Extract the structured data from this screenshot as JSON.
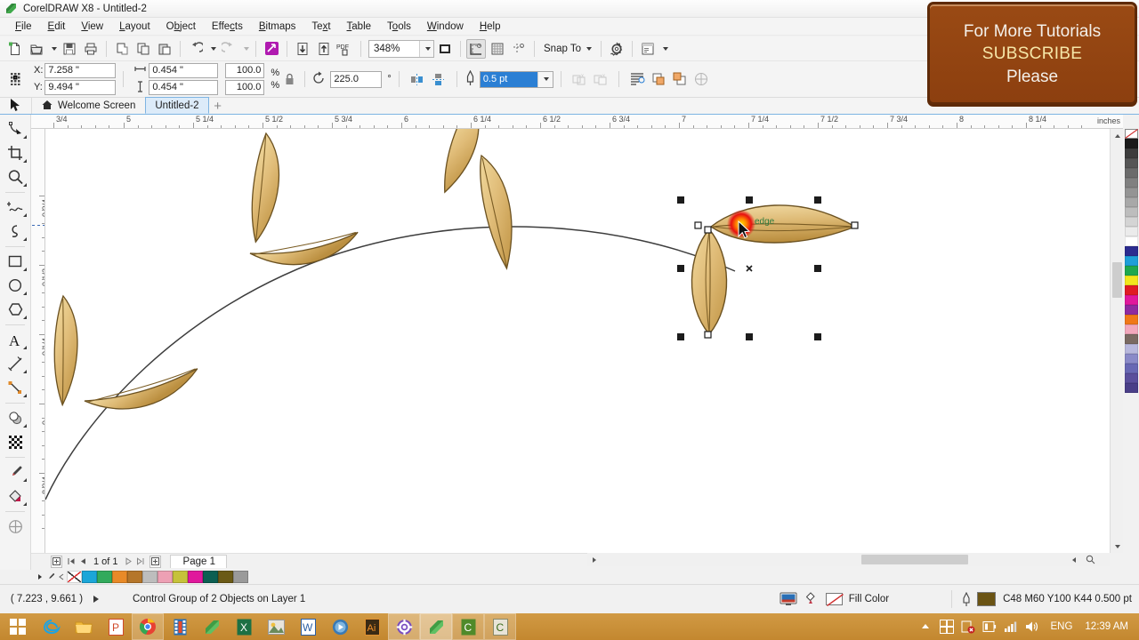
{
  "window": {
    "title": "CorelDRAW X8 - Untitled-2",
    "app_icon": "coreldraw-logo-icon"
  },
  "menu": [
    {
      "label": "File",
      "accel": "F"
    },
    {
      "label": "Edit",
      "accel": "E"
    },
    {
      "label": "View",
      "accel": "V"
    },
    {
      "label": "Layout",
      "accel": "L"
    },
    {
      "label": "Object",
      "accel": "O"
    },
    {
      "label": "Effects",
      "accel": "c"
    },
    {
      "label": "Bitmaps",
      "accel": "B"
    },
    {
      "label": "Text",
      "accel": "x"
    },
    {
      "label": "Table",
      "accel": "T"
    },
    {
      "label": "Tools",
      "accel": "o"
    },
    {
      "label": "Window",
      "accel": "W"
    },
    {
      "label": "Help",
      "accel": "H"
    }
  ],
  "toolbar": {
    "buttons": [
      {
        "name": "new-document-icon",
        "title": "New"
      },
      {
        "name": "open-document-icon",
        "title": "Open"
      },
      {
        "name": "open-dropdown-icon",
        "title": "Open options"
      },
      {
        "name": "save-icon",
        "title": "Save"
      },
      {
        "name": "print-icon",
        "title": "Print"
      },
      {
        "name": "cut-icon",
        "title": "Cut"
      },
      {
        "name": "copy-icon",
        "title": "Copy"
      },
      {
        "name": "paste-icon",
        "title": "Paste"
      },
      {
        "name": "undo-icon",
        "title": "Undo"
      },
      {
        "name": "undo-dropdown-icon",
        "title": "Undo history"
      },
      {
        "name": "redo-icon",
        "title": "Redo"
      },
      {
        "name": "redo-dropdown-icon",
        "title": "Redo history"
      },
      {
        "name": "search-content-icon",
        "title": "Search content"
      },
      {
        "name": "import-icon",
        "title": "Import"
      },
      {
        "name": "export-icon",
        "title": "Export"
      },
      {
        "name": "publish-pdf-icon",
        "title": "Publish to PDF"
      }
    ],
    "zoom_level": "348%",
    "zoom_dropdown_icon": "chevron-down-icon",
    "fullscreen_icon": "full-screen-preview-icon",
    "view_buttons": [
      {
        "name": "show-rulers-icon"
      },
      {
        "name": "show-grid-icon"
      },
      {
        "name": "show-guidelines-icon"
      }
    ],
    "snap_to_label": "Snap To",
    "snap_to_caret": "chevron-down-icon",
    "options_icon": "gear-icon",
    "dockers_icon": "dockers-icon",
    "dockers_caret": "chevron-down-icon"
  },
  "propbar": {
    "object_origin_icon": "object-origin-grid-icon",
    "x_label": "X:",
    "y_label": "Y:",
    "x_value": "7.258 \"",
    "y_value": "9.494 \"",
    "width_icon": "object-width-icon",
    "height_icon": "object-height-icon",
    "width_value": "0.454 \"",
    "height_value": "0.454 \"",
    "scale_x": "100.0",
    "scale_y": "100.0",
    "percent_sign": "%",
    "lock_ratio_icon": "lock-ratio-icon",
    "rotate_icon": "rotation-angle-icon",
    "rotation_value": "225.0",
    "degree_sign": "°",
    "mirror_h_icon": "mirror-horizontal-icon",
    "mirror_v_icon": "mirror-vertical-icon",
    "outline_pen_icon": "outline-pen-icon",
    "outline_width": "0.5 pt",
    "outline_caret": "chevron-down-icon",
    "weld_icon": "weld-icon",
    "trim_icon": "trim-icon",
    "text_wrap_icon": "wrap-paragraph-text-icon",
    "to_front_icon": "to-front-of-layer-icon",
    "to_back_icon": "to-back-of-layer-icon",
    "pixel_snap_icon": "snap-to-pixel-icon"
  },
  "tabs": {
    "pick_tool_icon": "pick-tool-icon",
    "items": [
      {
        "label": "Welcome Screen",
        "icon": "home-icon",
        "active": false
      },
      {
        "label": "Untitled-2",
        "icon": "",
        "active": true
      }
    ],
    "new_tab_icon": "plus-icon"
  },
  "toolbox": [
    {
      "name": "tool-pick",
      "icon": "pick-tool-icon",
      "active": false,
      "flyout": false
    },
    {
      "name": "tool-shape",
      "icon": "shape-tool-icon",
      "active": false,
      "flyout": true
    },
    {
      "name": "tool-crop",
      "icon": "crop-tool-icon",
      "active": false,
      "flyout": true
    },
    {
      "name": "tool-zoom",
      "icon": "zoom-tool-icon",
      "active": false,
      "flyout": true
    },
    {
      "name": "tool-freehand",
      "icon": "freehand-tool-icon",
      "active": false,
      "flyout": true
    },
    {
      "name": "tool-artistic-media",
      "icon": "artistic-media-tool-icon",
      "active": false,
      "flyout": true
    },
    {
      "name": "tool-rectangle",
      "icon": "rectangle-tool-icon",
      "active": false,
      "flyout": true
    },
    {
      "name": "tool-ellipse",
      "icon": "ellipse-tool-icon",
      "active": false,
      "flyout": true
    },
    {
      "name": "tool-polygon",
      "icon": "polygon-tool-icon",
      "active": false,
      "flyout": true
    },
    {
      "name": "tool-text",
      "icon": "text-tool-icon",
      "active": false,
      "flyout": true
    },
    {
      "name": "tool-parallel-dimension",
      "icon": "dimension-tool-icon",
      "active": false,
      "flyout": true
    },
    {
      "name": "tool-straight-line-connector",
      "icon": "connector-tool-icon",
      "active": false,
      "flyout": true
    },
    {
      "name": "tool-drop-shadow",
      "icon": "drop-shadow-tool-icon",
      "active": false,
      "flyout": true
    },
    {
      "name": "tool-transparency",
      "icon": "transparency-tool-icon",
      "active": false,
      "flyout": false
    },
    {
      "name": "tool-color-eyedropper",
      "icon": "eyedropper-tool-icon",
      "active": false,
      "flyout": true
    },
    {
      "name": "tool-interactive-fill",
      "icon": "interactive-fill-tool-icon",
      "active": false,
      "flyout": true
    },
    {
      "name": "tool-smart-fill",
      "icon": "smart-fill-tool-icon",
      "active": false,
      "flyout": false
    }
  ],
  "rulers": {
    "unit_label": "inches",
    "horizontal_labels": [
      "3/4",
      "5",
      "5 1/4",
      "5 1/2",
      "5 3/4",
      "6",
      "6 1/4",
      "6 1/2",
      "6 3/4",
      "7",
      "7 1/4",
      "7 1/2",
      "7 3/4",
      "8",
      "8 1/4"
    ],
    "vertical_labels": [
      "9 3/4",
      "9 1/2",
      "9 1/4",
      "9",
      "8 3/4"
    ]
  },
  "canvas": {
    "selection": {
      "handles": 8,
      "rotation_center_icon": "rotation-center-icon",
      "node_marker_icon": "node-marker-icon"
    },
    "cursor_hint": "edge",
    "cursor_icon": "shape-edit-cursor-icon",
    "leaf_fill_start": "#e8c87a",
    "leaf_fill_end": "#c49a4a",
    "leaf_outline": "#6b5120",
    "stem_color": "#3a3a3a",
    "highlight_color": "#e02020"
  },
  "pagenav": {
    "add_page_start_icon": "add-page-icon",
    "first_icon": "first-page-icon",
    "prev_icon": "previous-page-icon",
    "counter": "1 of 1",
    "next_icon": "next-page-icon",
    "last_icon": "last-page-icon",
    "add_page_end_icon": "add-page-icon",
    "page_tab": "Page 1"
  },
  "palette_bottom": {
    "controls": [
      "palette-scroll-up-icon",
      "palette-picker-icon",
      "palette-scroll-left-icon"
    ],
    "swatches": [
      "none",
      "#1ba6d8",
      "#32aa5c",
      "#e88a28",
      "#b5762a",
      "#bdbdbd",
      "#eda0b4",
      "#c6c23a",
      "#e0189c",
      "#0c5f52",
      "#6b5a16",
      "#9a9a9a"
    ]
  },
  "palette_right": {
    "swatches": [
      "none",
      "#1a1a1a",
      "#3d3d3d",
      "#555555",
      "#6b6b6b",
      "#808080",
      "#949494",
      "#a8a8a8",
      "#bdbdbd",
      "#d4d4d4",
      "#ebebeb",
      "#ffffff",
      "#2b2b8f",
      "#1e9fd8",
      "#1fa84e",
      "#f2e61c",
      "#e01b24",
      "#e0189c",
      "#8e2aa0",
      "#f07818",
      "#f2a8bc",
      "#7a6a62",
      "#b8b8dd",
      "#8a8ac8",
      "#6868b4",
      "#5a4f9c",
      "#4a3f88"
    ]
  },
  "statusbar": {
    "coords": "( 7.223 , 9.661 )",
    "expand_icon": "expand-status-icon",
    "object_info": "Control Group of 2 Objects on Layer 1",
    "color_proof_icon": "color-proof-settings-icon",
    "fill_swatch_icon": "fill-color-none-icon",
    "fill_label": "Fill Color",
    "outline_pen_icon": "outline-pen-icon",
    "outline_swatch_color": "#6b5414",
    "outline_info": "C48 M60 Y100 K44  0.500 pt"
  },
  "taskbar": {
    "start_icon": "windows-start-icon",
    "items": [
      {
        "name": "taskbar-internet-explorer",
        "icon": "internet-explorer-icon",
        "running": false
      },
      {
        "name": "taskbar-file-explorer",
        "icon": "file-explorer-icon",
        "running": false
      },
      {
        "name": "taskbar-powerpoint",
        "icon": "powerpoint-icon",
        "running": false
      },
      {
        "name": "taskbar-chrome",
        "icon": "chrome-icon",
        "running": true
      },
      {
        "name": "taskbar-camtasia",
        "icon": "camtasia-icon",
        "running": false
      },
      {
        "name": "taskbar-coreldraw",
        "icon": "coreldraw-icon",
        "running": false
      },
      {
        "name": "taskbar-excel",
        "icon": "excel-icon",
        "running": false
      },
      {
        "name": "taskbar-photo-viewer",
        "icon": "photo-viewer-icon",
        "running": false
      },
      {
        "name": "taskbar-word",
        "icon": "word-icon",
        "running": false
      },
      {
        "name": "taskbar-media-player",
        "icon": "media-player-icon",
        "running": false
      },
      {
        "name": "taskbar-illustrator",
        "icon": "illustrator-icon",
        "running": false
      },
      {
        "name": "taskbar-settings",
        "icon": "settings-gear-icon",
        "running": true
      },
      {
        "name": "taskbar-coreldraw-window",
        "icon": "coreldraw-icon",
        "running": true
      },
      {
        "name": "taskbar-corel-connect-1",
        "icon": "corel-capture-icon",
        "running": true
      },
      {
        "name": "taskbar-corel-connect-2",
        "icon": "corel-capture-icon",
        "running": true
      }
    ],
    "tray": {
      "show_hidden_icon": "show-hidden-icons-icon",
      "icons": [
        "windows-defender-icon",
        "action-center-icon",
        "battery-icon",
        "network-icon",
        "volume-icon"
      ],
      "language": "ENG",
      "clock": "12:39 AM"
    }
  },
  "overlay": {
    "line1": "For More Tutorials",
    "line2": "SUBSCRIBE",
    "line3": "Please"
  }
}
